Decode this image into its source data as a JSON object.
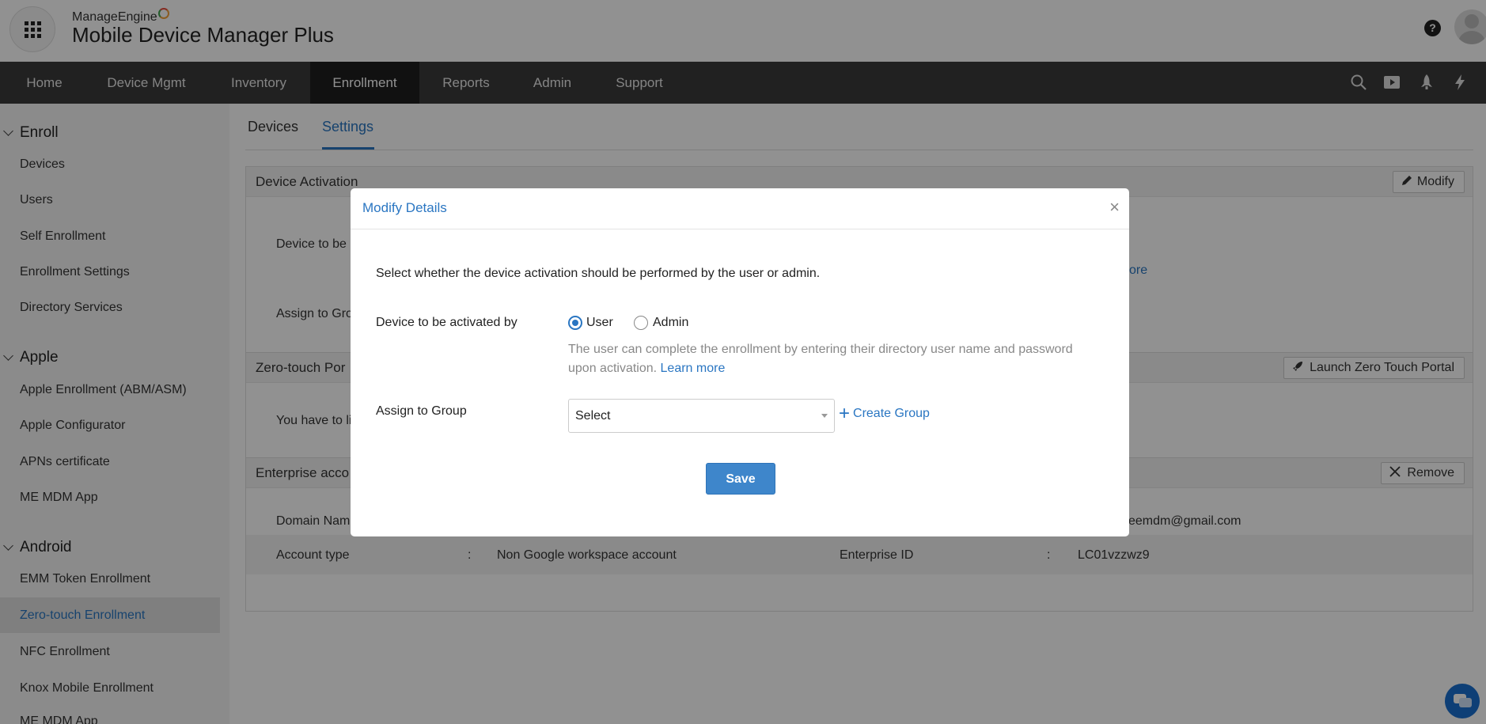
{
  "header": {
    "brand_small": "ManageEngine",
    "brand_big": "Mobile Device Manager Plus"
  },
  "nav": {
    "items": [
      "Home",
      "Device Mgmt",
      "Inventory",
      "Enrollment",
      "Reports",
      "Admin",
      "Support"
    ],
    "active": "Enrollment",
    "right_icons": [
      "search-icon",
      "video-icon",
      "rocket-icon",
      "bolt-icon"
    ]
  },
  "sidebar": {
    "groups": [
      {
        "label": "Enroll",
        "items": [
          "Devices",
          "Users",
          "Self Enrollment",
          "Enrollment Settings",
          "Directory Services"
        ]
      },
      {
        "label": "Apple",
        "items": [
          "Apple Enrollment (ABM/ASM)",
          "Apple Configurator",
          "APNs certificate",
          "ME MDM App"
        ]
      },
      {
        "label": "Android",
        "items": [
          "EMM Token Enrollment",
          "Zero-touch Enrollment",
          "NFC Enrollment",
          "Knox Mobile Enrollment",
          "ME MDM App"
        ]
      }
    ],
    "active_item": "Zero-touch Enrollment"
  },
  "main": {
    "tabs": [
      "Devices",
      "Settings"
    ],
    "active_tab": "Settings",
    "device_activation": {
      "title": "Device Activation",
      "modify_label": "Modify",
      "row1_label": "Device to be",
      "row1_link_tail": "ore",
      "row2_label": "Assign to Gro"
    },
    "zero_touch": {
      "title": "Zero-touch Por",
      "launch_label": "Launch Zero Touch Portal",
      "body_text": "You have to li"
    },
    "enterprise": {
      "title": "Enterprise acco",
      "remove_label": "Remove",
      "domain_label": "Domain Nam",
      "domain_value_tail": "eemdm@gmail.com",
      "account_type_label": "Account type",
      "colon": ":",
      "account_type_value": "Non Google workspace account",
      "enterprise_id_label": "Enterprise ID",
      "enterprise_id_value": "LC01vzzwz9"
    }
  },
  "modal": {
    "title": "Modify Details",
    "close": "×",
    "intro": "Select whether the device activation should be performed by the user or admin.",
    "activated_by_label": "Device to be activated by",
    "option_user": "User",
    "option_admin": "Admin",
    "selected_option": "User",
    "help_line1": "The user can complete the enrollment by entering their directory user name and password",
    "help_line2": "upon activation.",
    "learn_more": "Learn more",
    "group_label": "Assign to Group",
    "group_select_value": "Select",
    "create_group": "Create Group",
    "save": "Save"
  }
}
